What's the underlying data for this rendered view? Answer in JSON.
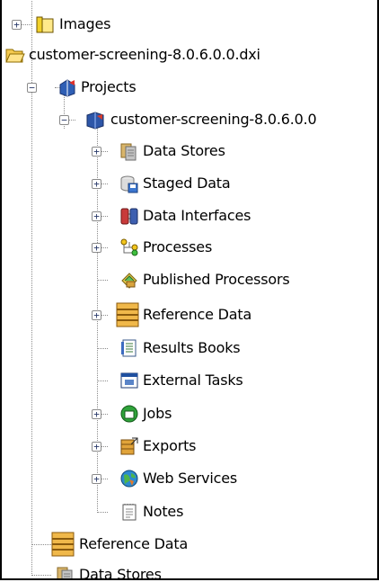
{
  "tree": {
    "nodes": [
      {
        "id": "images",
        "label": "Images",
        "icon": "folder-icon",
        "expander": "+"
      },
      {
        "id": "dxi",
        "label": "customer-screening-8.0.6.0.0.dxi",
        "icon": "open-folder-icon",
        "expander": ""
      },
      {
        "id": "projects",
        "label": "Projects",
        "icon": "projects-icon",
        "expander": "−"
      },
      {
        "id": "project",
        "label": "customer-screening-8.0.6.0.0",
        "icon": "project-book-icon",
        "expander": "−"
      },
      {
        "id": "datastores",
        "label": "Data Stores",
        "icon": "data-store-icon",
        "expander": "+"
      },
      {
        "id": "staged",
        "label": "Staged Data",
        "icon": "staged-data-icon",
        "expander": "+"
      },
      {
        "id": "interfaces",
        "label": "Data Interfaces",
        "icon": "data-interface-icon",
        "expander": "+"
      },
      {
        "id": "processes",
        "label": "Processes",
        "icon": "process-icon",
        "expander": "+"
      },
      {
        "id": "published",
        "label": "Published Processors",
        "icon": "published-processor-icon",
        "expander": ""
      },
      {
        "id": "refdata",
        "label": "Reference Data",
        "icon": "reference-data-icon",
        "expander": "+"
      },
      {
        "id": "results",
        "label": "Results Books",
        "icon": "results-book-icon",
        "expander": ""
      },
      {
        "id": "external",
        "label": "External Tasks",
        "icon": "external-task-icon",
        "expander": ""
      },
      {
        "id": "jobs",
        "label": "Jobs",
        "icon": "job-icon",
        "expander": "+"
      },
      {
        "id": "exports",
        "label": "Exports",
        "icon": "export-icon",
        "expander": "+"
      },
      {
        "id": "webservices",
        "label": "Web Services",
        "icon": "web-service-icon",
        "expander": "+"
      },
      {
        "id": "notes",
        "label": "Notes",
        "icon": "notes-icon",
        "expander": ""
      },
      {
        "id": "refdata2",
        "label": "Reference Data",
        "icon": "reference-data-icon",
        "expander": ""
      },
      {
        "id": "datastores2",
        "label": "Data Stores",
        "icon": "data-store-icon",
        "expander": ""
      }
    ]
  }
}
